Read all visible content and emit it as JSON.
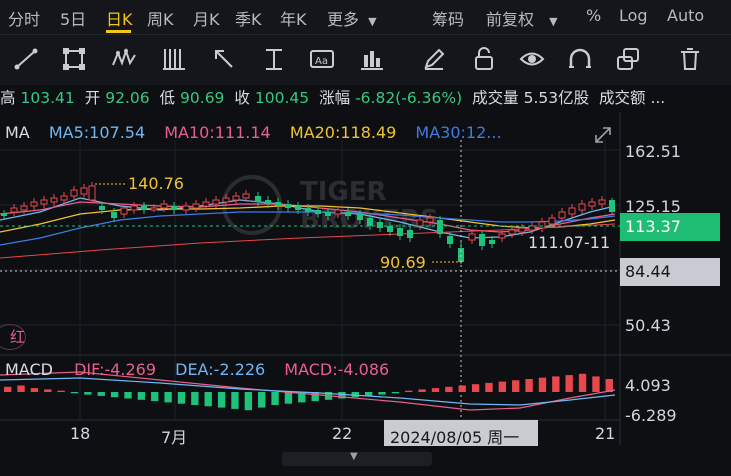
{
  "period_tabs": [
    "分时",
    "5日",
    "日K",
    "周K",
    "月K",
    "季K",
    "年K",
    "更多"
  ],
  "active_tab": "日K",
  "right_tabs": [
    "筹码",
    "前复权",
    "%",
    "Log",
    "Auto"
  ],
  "toolbar_icons": [
    "line-tool-icon",
    "rectangle-tool-icon",
    "pattern-tool-icon",
    "fib-lines-icon",
    "arrow-tool-icon",
    "vertical-line-icon",
    "text-tool-icon",
    "bar-chart-icon",
    "pencil-icon",
    "lock-icon",
    "eye-icon",
    "magnet-icon",
    "duplicate-icon",
    "trash-icon"
  ],
  "quote": {
    "high_label": "高",
    "high": "103.41",
    "open_label": "开",
    "open": "92.06",
    "low_label": "低",
    "low": "90.69",
    "close_label": "收",
    "close": "100.45",
    "change_label": "涨幅",
    "change": "-6.82(-6.36%)",
    "volume_label": "成交量",
    "volume": "5.53亿股",
    "turnover_label": "成交额 ..."
  },
  "ma_legend": {
    "title": "MA",
    "ma5": "MA5:107.54",
    "ma10": "MA10:111.14",
    "ma20": "MA20:118.49",
    "ma30": "MA30:12..."
  },
  "macd_legend": {
    "title": "MACD",
    "dif": "DIF:-4.269",
    "dea": "DEA:-2.226",
    "macd": "MACD:-4.086"
  },
  "annotations": {
    "high_mark": "140.76",
    "low_mark": "90.69",
    "crosshair_value": "111.07-11"
  },
  "price_axis": {
    "top": "162.51",
    "upper": "125.15",
    "current": "113.37",
    "crosshair": "84.44",
    "lower": "50.43"
  },
  "macd_axis": {
    "top": "4.093",
    "bottom": "-6.289"
  },
  "x_axis": [
    "18",
    "7月",
    "22",
    "21"
  ],
  "crosshair_date": "2024/08/05 周一",
  "red_badge": "红",
  "colors": {
    "up": "#e8484d",
    "down": "#1fc27a",
    "ma5": "#6fb7f4",
    "ma10": "#e8608a",
    "ma20": "#f1c232",
    "ma30": "#3d7be0",
    "accent": "#f5c518"
  }
}
